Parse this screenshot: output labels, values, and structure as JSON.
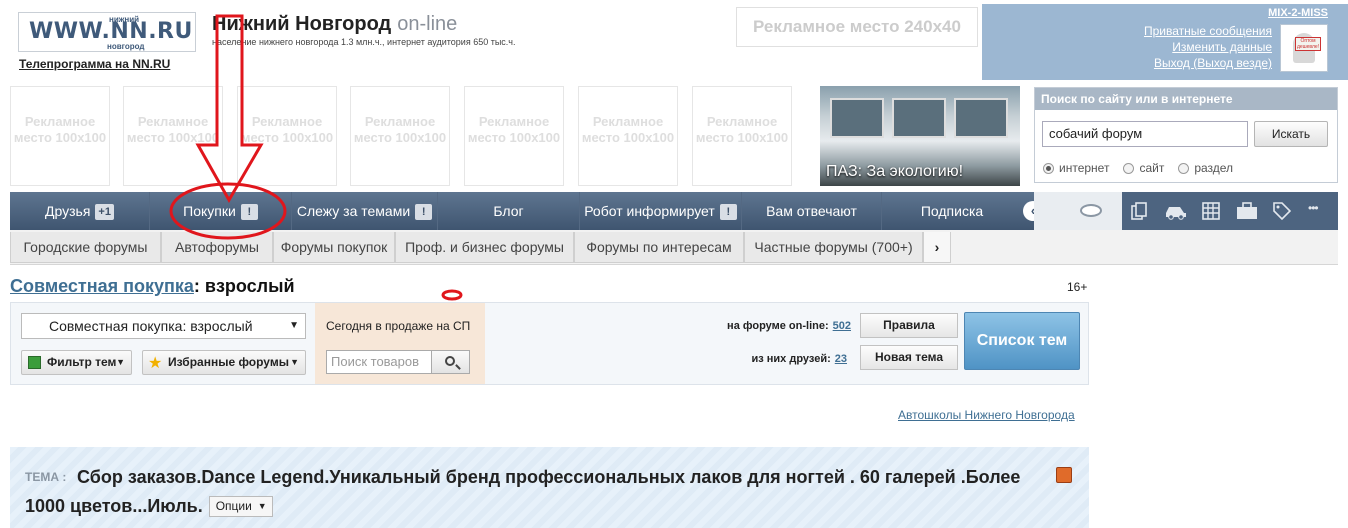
{
  "header": {
    "logo": {
      "main": "WWW.NN.RU",
      "small_top": "нижний",
      "small_bottom": "новгород"
    },
    "tv_link": "Телепрограмма на NN.RU",
    "site_title": "Нижний Новгород",
    "site_title_suffix": "on-line",
    "site_subtitle": "население нижнего новгорода 1.3 млн.ч., интернет аудитория 650 тыс.ч.",
    "ad_240": "Рекламное место 240x40"
  },
  "user": {
    "name": "MIX-2-MISS",
    "links": [
      "Приватные сообщения",
      "Изменить данные",
      "Выход (Выход везде)"
    ],
    "avatar_sign": "Оптом дешевле!"
  },
  "ads_100": [
    "Рекламное место 100x100",
    "Рекламное место 100x100",
    "Рекламное место 100x100",
    "Рекламное место 100x100",
    "Рекламное место 100x100",
    "Рекламное место 100x100",
    "Рекламное место 100x100"
  ],
  "promo": {
    "caption": "ПАЗ: За экологию!"
  },
  "search": {
    "title": "Поиск по сайту или в интернете",
    "value": "собачий форум",
    "button": "Искать",
    "options": [
      "интернет",
      "сайт",
      "раздел"
    ],
    "selected": "интернет"
  },
  "nav": {
    "items": [
      {
        "label": "Друзья",
        "badge": "+1"
      },
      {
        "label": "Покупки",
        "badge": "!"
      },
      {
        "label": "Слежу за темами",
        "badge": "!"
      },
      {
        "label": "Блог",
        "badge": ""
      },
      {
        "label": "Робот информирует",
        "badge": "!"
      },
      {
        "label": "Вам отвечают",
        "badge": ""
      },
      {
        "label": "Подписка",
        "badge": ""
      }
    ],
    "scroll_arrow": "‹",
    "icons": [
      "chat-icon",
      "documents-icon",
      "car-icon",
      "grid-icon",
      "briefcase-icon",
      "tag-icon",
      "more-icon"
    ],
    "more_glyph": "•••"
  },
  "subnav": {
    "items": [
      "Городские форумы",
      "Автофорумы",
      "Форумы покупок",
      "Проф. и бизнес форумы",
      "Форумы по интересам",
      "Частные форумы (700+)"
    ],
    "more": "›"
  },
  "page": {
    "section_link": "Совместная покупка",
    "section_rest": ": взрослый",
    "age": "16+"
  },
  "toolbar": {
    "forum_select": "Совместная покупка: взрослый",
    "filter_btn": "Фильтр тем",
    "fav_btn": "Избранные форумы",
    "sp_today": "Сегодня в продаже на СП",
    "sp_placeholder": "Поиск товаров",
    "online_label": "на форуме on-line:",
    "online_count": "502",
    "friends_label": "из них друзей:",
    "friends_count": "23",
    "rules_btn": "Правила",
    "new_topic_btn": "Новая тема",
    "topics_btn": "Список тем"
  },
  "autoschool_link": "Автошколы Нижнего Новгорода",
  "topic": {
    "label": "ТЕМА :",
    "title": "Сбор заказов.Dance Legend.Уникальный бренд профессиональных лаков для ногтей . 60 галерей .Более 1000 цветов...Июль.",
    "options": "Опции"
  },
  "colors": {
    "nav": "#4d6480",
    "link": "#3f6f93",
    "user_panel": "#9cb7d2",
    "annotation": "#e0161c"
  }
}
